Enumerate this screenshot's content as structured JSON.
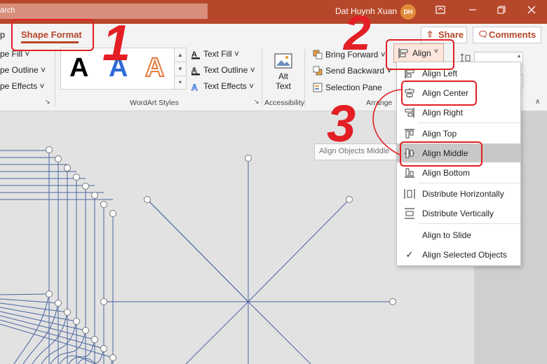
{
  "titlebar": {
    "search_text": "arch",
    "user_name": "Dat Huynh Xuan",
    "avatar_initials": "DH"
  },
  "ribbon": {
    "tabs": [
      {
        "label": "p"
      },
      {
        "label": "Shape Format",
        "active": true
      }
    ],
    "share_label": "Share",
    "comments_label": "Comments",
    "shape_styles": {
      "fill_label": "pe Fill",
      "outline_label": "pe Outline",
      "effects_label": "pe Effects"
    },
    "wordart": {
      "sample_letter": "A",
      "text_fill_label": "Text Fill",
      "text_outline_label": "Text Outline",
      "text_effects_label": "Text Effects",
      "group_label": "WordArt Styles"
    },
    "accessibility": {
      "alt_text_line1": "Alt",
      "alt_text_line2": "Text",
      "group_label": "Accessibility"
    },
    "arrange": {
      "bring_forward_label": "Bring Forward",
      "send_backward_label": "Send Backward",
      "selection_pane_label": "Selection Pane",
      "align_label": "Align",
      "group_label": "Arrange"
    }
  },
  "tooltip": {
    "text": "Align Objects Middle"
  },
  "align_menu": {
    "items": [
      {
        "label": "Align Left",
        "icon": "align-left-icon"
      },
      {
        "label": "Align Center",
        "icon": "align-center-icon"
      },
      {
        "label": "Align Right",
        "icon": "align-right-icon"
      },
      {
        "label": "Align Top",
        "icon": "align-top-icon"
      },
      {
        "label": "Align Middle",
        "icon": "align-middle-icon",
        "highlighted": true
      },
      {
        "label": "Align Bottom",
        "icon": "align-bottom-icon"
      },
      {
        "label": "Distribute Horizontally",
        "icon": "distribute-horizontally-icon"
      },
      {
        "label": "Distribute Vertically",
        "icon": "distribute-vertically-icon"
      },
      {
        "label": "Align to Slide",
        "icon": ""
      },
      {
        "label": "Align Selected Objects",
        "icon": "check-icon",
        "checked": true
      }
    ]
  },
  "annotations": {
    "step1": "1",
    "step2": "2",
    "step3": "3"
  },
  "colors": {
    "accent": "#b7472a",
    "annotation_red": "#e31e24",
    "shape_line": "#4a66a0",
    "menu_highlight": "#c8c8c8"
  }
}
